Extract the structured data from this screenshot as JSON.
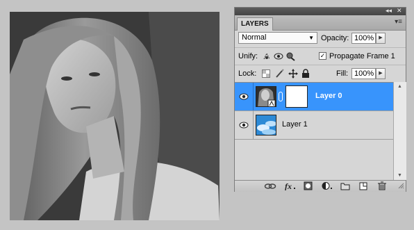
{
  "canvas": {
    "image": "portrait-photo-black-and-white"
  },
  "panel": {
    "tab_label": "LAYERS",
    "titlebar_icons": [
      "collapse-icon",
      "close-icon"
    ],
    "menu_icon": "panel-menu-icon",
    "blend_mode": "Normal",
    "opacity_label": "Opacity:",
    "opacity_value": "100%",
    "unify_label": "Unify:",
    "propagate_label": "Propagate Frame 1",
    "propagate_checked": true,
    "lock_label": "Lock:",
    "fill_label": "Fill:",
    "fill_value": "100%",
    "layers": [
      {
        "name": "Layer 0",
        "selected": true,
        "visible": true,
        "has_mask": true,
        "thumb": "portrait-thumbnail"
      },
      {
        "name": "Layer 1",
        "selected": false,
        "visible": true,
        "has_mask": false,
        "thumb": "sky-clouds-thumbnail"
      }
    ],
    "footer_icons": [
      "link-layers-icon",
      "fx-icon",
      "add-mask-icon",
      "adjustment-layer-icon",
      "new-group-icon",
      "new-layer-icon",
      "delete-icon"
    ]
  },
  "colors": {
    "selection": "#3894fc",
    "panel_bg": "#d6d6d6",
    "background": "#c4c4c4"
  }
}
